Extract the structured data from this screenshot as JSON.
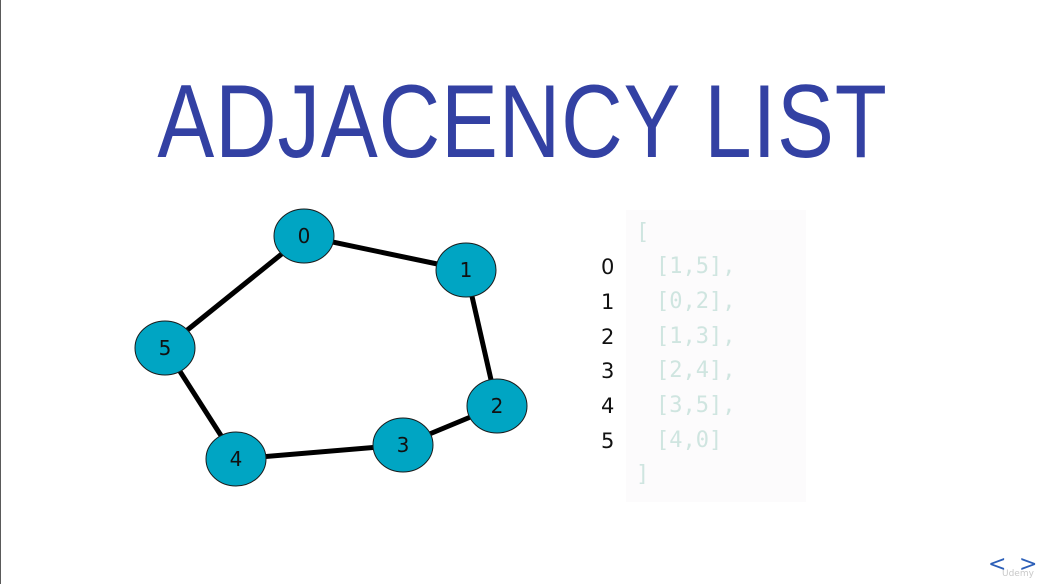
{
  "title": "ADJACENCY LIST",
  "graph": {
    "nodes": [
      "0",
      "1",
      "2",
      "3",
      "4",
      "5"
    ],
    "edges": [
      [
        "0",
        "1"
      ],
      [
        "1",
        "2"
      ],
      [
        "2",
        "3"
      ],
      [
        "3",
        "4"
      ],
      [
        "4",
        "5"
      ],
      [
        "5",
        "0"
      ]
    ],
    "node_color": "#00a5c3",
    "edge_color": "#000000"
  },
  "adjacency": {
    "open": "[",
    "close": "]",
    "rows": [
      {
        "index": "0",
        "list": "[1,5],"
      },
      {
        "index": "1",
        "list": "[0,2],"
      },
      {
        "index": "2",
        "list": "[1,3],"
      },
      {
        "index": "3",
        "list": "[2,4],"
      },
      {
        "index": "4",
        "list": "[3,5],"
      },
      {
        "index": "5",
        "list": "[4,0]"
      }
    ]
  },
  "nav": {
    "prev_icon": "chevron-left-icon",
    "next_icon": "chevron-right-icon",
    "prev": "<",
    "next": ">"
  },
  "watermark": "Udemy",
  "colors": {
    "title": "#3341a3",
    "code_text": "#cfe5e0",
    "nav": "#2c5fb8"
  }
}
